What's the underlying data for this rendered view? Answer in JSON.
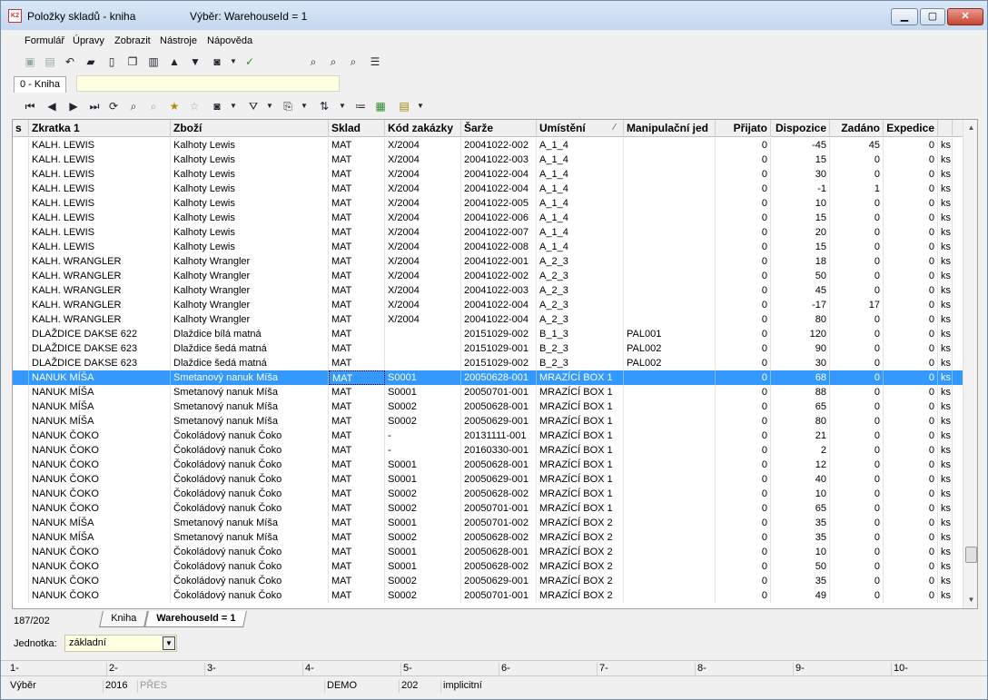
{
  "window": {
    "title": "Položky skladů - kniha",
    "selection": "Výběr: WarehouseId = 1",
    "app_icon_text": "K2"
  },
  "menu": [
    {
      "label": "Formulář"
    },
    {
      "label": "Úpravy"
    },
    {
      "label": "Zobrazit"
    },
    {
      "label": "Nástroje"
    },
    {
      "label": "Nápověda"
    }
  ],
  "form_tab": {
    "label": "0 - Kniha"
  },
  "grid": {
    "columns": [
      "s",
      "Zkratka 1",
      "Zboží",
      "Sklad",
      "Kód zakázky",
      "Šarže",
      "Umístění",
      "Manipulační jed",
      "Přijato",
      "Dispozice",
      "Zadáno",
      "Expedice",
      ""
    ],
    "rows": [
      [
        "",
        "KALH. LEWIS",
        "Kalhoty Lewis",
        "MAT",
        "X/2004",
        "20041022-002",
        "A_1_4",
        "",
        "0",
        "-45",
        "45",
        "0",
        "ks"
      ],
      [
        "",
        "KALH. LEWIS",
        "Kalhoty Lewis",
        "MAT",
        "X/2004",
        "20041022-003",
        "A_1_4",
        "",
        "0",
        "15",
        "0",
        "0",
        "ks"
      ],
      [
        "",
        "KALH. LEWIS",
        "Kalhoty Lewis",
        "MAT",
        "X/2004",
        "20041022-004",
        "A_1_4",
        "",
        "0",
        "30",
        "0",
        "0",
        "ks"
      ],
      [
        "",
        "KALH. LEWIS",
        "Kalhoty Lewis",
        "MAT",
        "X/2004",
        "20041022-004",
        "A_1_4",
        "",
        "0",
        "-1",
        "1",
        "0",
        "ks"
      ],
      [
        "",
        "KALH. LEWIS",
        "Kalhoty Lewis",
        "MAT",
        "X/2004",
        "20041022-005",
        "A_1_4",
        "",
        "0",
        "10",
        "0",
        "0",
        "ks"
      ],
      [
        "",
        "KALH. LEWIS",
        "Kalhoty Lewis",
        "MAT",
        "X/2004",
        "20041022-006",
        "A_1_4",
        "",
        "0",
        "15",
        "0",
        "0",
        "ks"
      ],
      [
        "",
        "KALH. LEWIS",
        "Kalhoty Lewis",
        "MAT",
        "X/2004",
        "20041022-007",
        "A_1_4",
        "",
        "0",
        "20",
        "0",
        "0",
        "ks"
      ],
      [
        "",
        "KALH. LEWIS",
        "Kalhoty Lewis",
        "MAT",
        "X/2004",
        "20041022-008",
        "A_1_4",
        "",
        "0",
        "15",
        "0",
        "0",
        "ks"
      ],
      [
        "",
        "KALH. WRANGLER",
        "Kalhoty Wrangler",
        "MAT",
        "X/2004",
        "20041022-001",
        "A_2_3",
        "",
        "0",
        "18",
        "0",
        "0",
        "ks"
      ],
      [
        "",
        "KALH. WRANGLER",
        "Kalhoty Wrangler",
        "MAT",
        "X/2004",
        "20041022-002",
        "A_2_3",
        "",
        "0",
        "50",
        "0",
        "0",
        "ks"
      ],
      [
        "",
        "KALH. WRANGLER",
        "Kalhoty Wrangler",
        "MAT",
        "X/2004",
        "20041022-003",
        "A_2_3",
        "",
        "0",
        "45",
        "0",
        "0",
        "ks"
      ],
      [
        "",
        "KALH. WRANGLER",
        "Kalhoty Wrangler",
        "MAT",
        "X/2004",
        "20041022-004",
        "A_2_3",
        "",
        "0",
        "-17",
        "17",
        "0",
        "ks"
      ],
      [
        "",
        "KALH. WRANGLER",
        "Kalhoty Wrangler",
        "MAT",
        "X/2004",
        "20041022-004",
        "A_2_3",
        "",
        "0",
        "80",
        "0",
        "0",
        "ks"
      ],
      [
        "",
        "DLAŽDICE DAKSE 622",
        "Dlaždice bílá matná",
        "MAT",
        "",
        "20151029-002",
        "B_1_3",
        "PAL001",
        "0",
        "120",
        "0",
        "0",
        "ks"
      ],
      [
        "",
        "DLAŽDICE DAKSE 623",
        "Dlaždice šedá matná",
        "MAT",
        "",
        "20151029-001",
        "B_2_3",
        "PAL002",
        "0",
        "90",
        "0",
        "0",
        "ks"
      ],
      [
        "",
        "DLAŽDICE DAKSE 623",
        "Dlaždice šedá matná",
        "MAT",
        "",
        "20151029-002",
        "B_2_3",
        "PAL002",
        "0",
        "30",
        "0",
        "0",
        "ks"
      ],
      [
        "",
        "NANUK MÍŠA",
        "Smetanový nanuk Míša",
        "MAT",
        "S0001",
        "20050628-001",
        "MRAZÍCÍ BOX 1",
        "",
        "0",
        "68",
        "0",
        "0",
        "ks"
      ],
      [
        "",
        "NANUK MÍŠA",
        "Smetanový nanuk Míša",
        "MAT",
        "S0001",
        "20050701-001",
        "MRAZÍCÍ BOX 1",
        "",
        "0",
        "88",
        "0",
        "0",
        "ks"
      ],
      [
        "",
        "NANUK MÍŠA",
        "Smetanový nanuk Míša",
        "MAT",
        "S0002",
        "20050628-001",
        "MRAZÍCÍ BOX 1",
        "",
        "0",
        "65",
        "0",
        "0",
        "ks"
      ],
      [
        "",
        "NANUK MÍŠA",
        "Smetanový nanuk Míša",
        "MAT",
        "S0002",
        "20050629-001",
        "MRAZÍCÍ BOX 1",
        "",
        "0",
        "80",
        "0",
        "0",
        "ks"
      ],
      [
        "",
        "NANUK ČOKO",
        "Čokoládový nanuk Čoko",
        "MAT",
        "-",
        "20131111-001",
        "MRAZÍCÍ BOX 1",
        "",
        "0",
        "21",
        "0",
        "0",
        "ks"
      ],
      [
        "",
        "NANUK ČOKO",
        "Čokoládový nanuk Čoko",
        "MAT",
        "-",
        "20160330-001",
        "MRAZÍCÍ BOX 1",
        "",
        "0",
        "2",
        "0",
        "0",
        "ks"
      ],
      [
        "",
        "NANUK ČOKO",
        "Čokoládový nanuk Čoko",
        "MAT",
        "S0001",
        "20050628-001",
        "MRAZÍCÍ BOX 1",
        "",
        "0",
        "12",
        "0",
        "0",
        "ks"
      ],
      [
        "",
        "NANUK ČOKO",
        "Čokoládový nanuk Čoko",
        "MAT",
        "S0001",
        "20050629-001",
        "MRAZÍCÍ BOX 1",
        "",
        "0",
        "40",
        "0",
        "0",
        "ks"
      ],
      [
        "",
        "NANUK ČOKO",
        "Čokoládový nanuk Čoko",
        "MAT",
        "S0002",
        "20050628-002",
        "MRAZÍCÍ BOX 1",
        "",
        "0",
        "10",
        "0",
        "0",
        "ks"
      ],
      [
        "",
        "NANUK ČOKO",
        "Čokoládový nanuk Čoko",
        "MAT",
        "S0002",
        "20050701-001",
        "MRAZÍCÍ BOX 1",
        "",
        "0",
        "65",
        "0",
        "0",
        "ks"
      ],
      [
        "",
        "NANUK MÍŠA",
        "Smetanový nanuk Míša",
        "MAT",
        "S0001",
        "20050701-002",
        "MRAZÍCÍ BOX 2",
        "",
        "0",
        "35",
        "0",
        "0",
        "ks"
      ],
      [
        "",
        "NANUK MÍŠA",
        "Smetanový nanuk Míša",
        "MAT",
        "S0002",
        "20050628-002",
        "MRAZÍCÍ BOX 2",
        "",
        "0",
        "35",
        "0",
        "0",
        "ks"
      ],
      [
        "",
        "NANUK ČOKO",
        "Čokoládový nanuk Čoko",
        "MAT",
        "S0001",
        "20050628-001",
        "MRAZÍCÍ BOX 2",
        "",
        "0",
        "10",
        "0",
        "0",
        "ks"
      ],
      [
        "",
        "NANUK ČOKO",
        "Čokoládový nanuk Čoko",
        "MAT",
        "S0001",
        "20050628-002",
        "MRAZÍCÍ BOX 2",
        "",
        "0",
        "50",
        "0",
        "0",
        "ks"
      ],
      [
        "",
        "NANUK ČOKO",
        "Čokoládový nanuk Čoko",
        "MAT",
        "S0002",
        "20050629-001",
        "MRAZÍCÍ BOX 2",
        "",
        "0",
        "35",
        "0",
        "0",
        "ks"
      ],
      [
        "",
        "NANUK ČOKO",
        "Čokoládový nanuk Čoko",
        "MAT",
        "S0002",
        "20050701-001",
        "MRAZÍCÍ BOX 2",
        "",
        "0",
        "49",
        "0",
        "0",
        "ks"
      ]
    ],
    "selected_row": 16
  },
  "record_count": "187/202",
  "bottom_tabs": [
    {
      "label": "Kniha",
      "active": false
    },
    {
      "label": "WarehouseId = 1",
      "active": true
    }
  ],
  "unit": {
    "label": "Jednotka:",
    "value": "základní"
  },
  "function_keys": [
    "1-",
    "2-",
    "3-",
    "4-",
    "5-",
    "6-",
    "7-",
    "8-",
    "9-",
    "10-"
  ],
  "status": {
    "mode": "Výběr",
    "year": "2016",
    "overwrite": "PŘES",
    "database": "DEMO",
    "code": "202",
    "default": "implicitní"
  },
  "colors": {
    "selection": "#3399ff",
    "yellow_field": "#ffffe1"
  }
}
